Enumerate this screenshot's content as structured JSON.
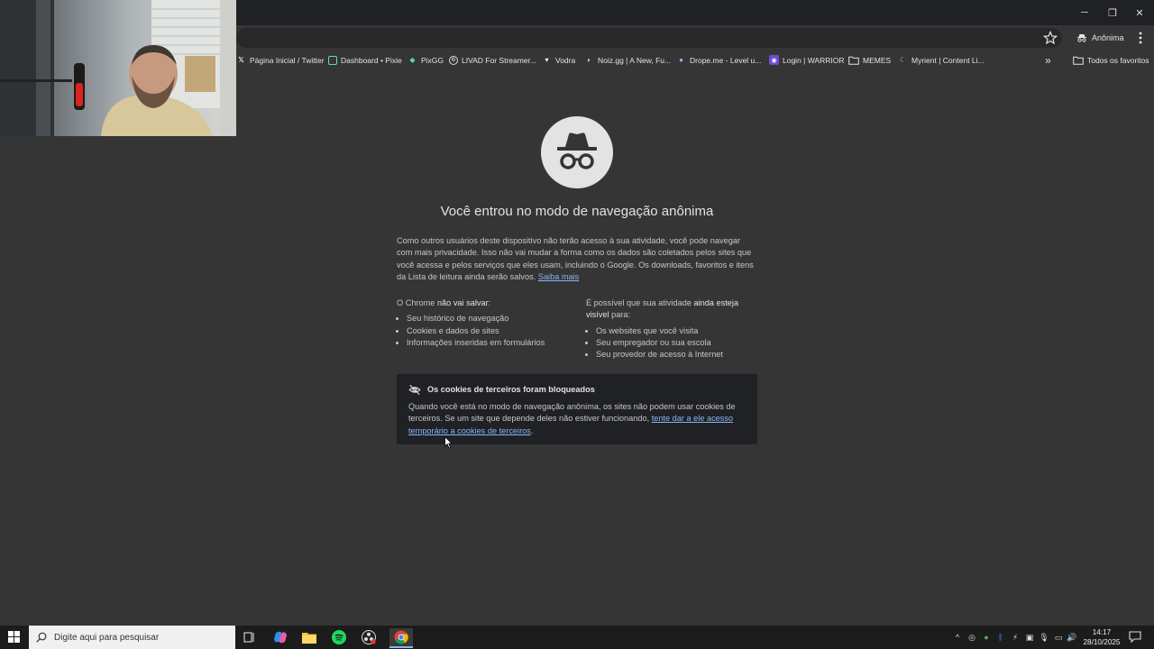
{
  "window": {
    "minimize_glyph": "─",
    "restore_glyph": "❐",
    "close_glyph": "✕"
  },
  "toolbar": {
    "profile_label": "Anônima"
  },
  "bookmarks": [
    {
      "label": "Página Inicial / Twitter",
      "icon": "x-logo-icon"
    },
    {
      "label": "Dashboard • Pixie",
      "icon": "pixie-icon"
    },
    {
      "label": "PixGG",
      "icon": "pixgg-icon"
    },
    {
      "label": "LIVAD For Streamer...",
      "icon": "livad-icon"
    },
    {
      "label": "Vodra",
      "icon": "vodra-icon"
    },
    {
      "label": "Noiz.gg | A New, Fu...",
      "icon": "noiz-icon"
    },
    {
      "label": "Drope.me - Level u...",
      "icon": "drope-icon"
    },
    {
      "label": "Login | WARRIOR",
      "icon": "warrior-icon"
    },
    {
      "label": "MEMES",
      "icon": "folder-icon"
    },
    {
      "label": "Myrient | Content Li...",
      "icon": "myrient-icon"
    }
  ],
  "bookmarks_overflow": "»",
  "all_bookmarks_label": "Todos os favoritos",
  "incognito": {
    "headline": "Você entrou no modo de navegação anônima",
    "intro": "Como outros usuários deste dispositivo não terão acesso à sua atividade, você pode navegar com mais privacidade. Isso não vai mudar a forma como os dados são coletados pelos sites que você acessa e pelos serviços que eles usam, incluindo o Google. Os downloads, favoritos e itens da Lista de leitura ainda serão salvos.",
    "learn_more": "Saiba mais",
    "not_saved_prefix": "O Chrome ",
    "not_saved_bold": "não vai salvar",
    "not_saved_suffix": ":",
    "not_saved_items": [
      "Seu histórico de navegação",
      "Cookies e dados de sites",
      "Informações inseridas em formulários"
    ],
    "visible_prefix": "É possível que sua atividade ",
    "visible_bold": "ainda esteja visível",
    "visible_suffix": " para:",
    "visible_items": [
      "Os websites que você visita",
      "Seu empregador ou sua escola",
      "Seu provedor de acesso à Internet"
    ]
  },
  "cookies_card": {
    "title": "Os cookies de terceiros foram bloqueados",
    "body": "Quando você está no modo de navegação anônima, os sites não podem usar cookies de terceiros. Se um site que depende deles não estiver funcionando, ",
    "link": "tente dar a ele acesso temporário a cookies de terceiros",
    "body_end": "."
  },
  "taskbar": {
    "search_placeholder": "Digite aqui para pesquisar",
    "time": "14:17",
    "date": "28/10/2025"
  }
}
